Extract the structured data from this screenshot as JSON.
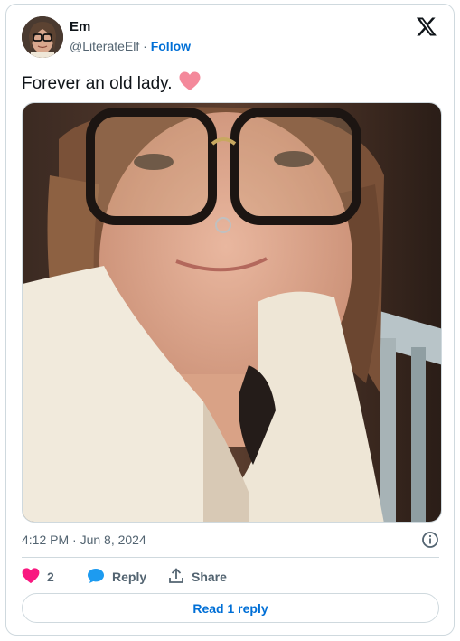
{
  "author": {
    "name": "Em",
    "handle": "@LiterateElf",
    "separator": " · ",
    "follow_label": "Follow"
  },
  "tweet": {
    "text": "Forever an old lady.",
    "emoji_icon": "pink-heart-icon",
    "timestamp": "4:12 PM · Jun 8, 2024"
  },
  "actions": {
    "like_count": "2",
    "reply_label": "Reply",
    "share_label": "Share"
  },
  "read_reply_label": "Read 1 reply",
  "colors": {
    "link_blue": "#006fd6",
    "like_pink": "#f91880",
    "border": "#cfd9de",
    "muted_text": "#536471"
  },
  "icons": [
    "x-logo-icon",
    "info-icon",
    "heart-icon",
    "reply-bubble-icon",
    "share-upload-icon"
  ]
}
